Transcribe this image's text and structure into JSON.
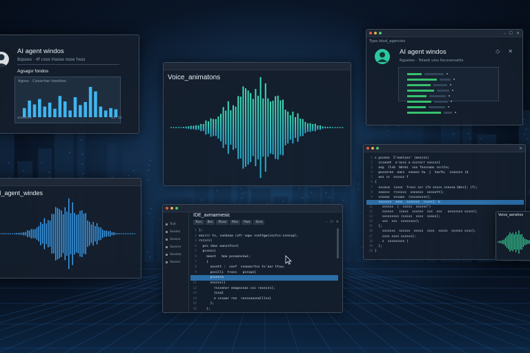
{
  "colors": {
    "background": "#0a1628",
    "accent_teal": "#3ee0b0",
    "accent_blue": "#4fb8e8",
    "window_bg": "#141e2c",
    "green_progress": "#38c16e",
    "highlight_line": "#2b6ea8"
  },
  "agent_window_left": {
    "title": "AI agent windos",
    "subtitle": "Bqsses · 4f coss Hasse osse hsss",
    "section": "Agsagsr fondos",
    "panel_title": "Agsss · Cossnhar toodoss",
    "footer_left": "sssssssss",
    "footer_right": "11 · 12",
    "bar_values": [
      0.3,
      0.55,
      0.42,
      0.6,
      0.35,
      0.48,
      0.28,
      0.7,
      0.52,
      0.22,
      0.66,
      0.4,
      0.5,
      1.0,
      0.85,
      0.35,
      0.22,
      0.3,
      0.26
    ],
    "icons": {
      "avatar": "user-avatar-icon"
    }
  },
  "voice_window": {
    "title": "Voice_animatons"
  },
  "agent_window_right": {
    "title_bar_label": "Typo   blod_agercios",
    "title": "AI agent windos",
    "subtitle": "Rgsates · Tolastl ulss llscsosrsatts",
    "control_a": "◇",
    "control_b": "✕",
    "progress": [
      0.3,
      0.62,
      0.48,
      0.55,
      0.4,
      0.5,
      0.38,
      0.7
    ],
    "icons": {
      "avatar": "agent-avatar-icon"
    }
  },
  "audio_window_left": {
    "title": "I_agent_windes"
  },
  "ide_window": {
    "title_bar": "",
    "title": "IDE_avmarmesic",
    "tabs": [
      "Tocs",
      "Bss",
      "Ploas",
      "Moc",
      "Pwo",
      "Ssra"
    ],
    "sidebar_items": [
      "Tcot",
      "Sossks",
      "Sossco",
      "Sossrer",
      "Sosslas",
      "Sosses"
    ],
    "code_lines": [
      {
        "n": "1",
        "t": "};",
        "hl": false
      },
      {
        "n": "2",
        "t": "eosrcr ts, sasknaa (ofr vapv ssnttgw(ssctcs-ssnssp};",
        "hl": false
      },
      {
        "n": "3",
        "t": "rs(nrs)",
        "hl": false
      },
      {
        "n": "4",
        "t": "  pss skoc oanssfsssl",
        "hl": false
      },
      {
        "n": "5",
        "t": "  pcsnss(",
        "hl": false
      },
      {
        "n": "6",
        "t": "    anest   boo pssoonsnwi;",
        "hl": false
      },
      {
        "n": "7",
        "t": "    {",
        "hl": false
      },
      {
        "n": "8",
        "t": "      assntt :  cosf  svnoasrtss ts'aar ttsw;",
        "hl": false
      },
      {
        "n": "9",
        "t": "      pssilli  t+oss   pssspn{",
        "hl": false
      },
      {
        "n": "10",
        "t": "      pssnssa",
        "hl": true
      },
      {
        "n": "11",
        "t": "      nsssss()",
        "hl": false
      },
      {
        "n": "12",
        "t": "        rsssensr enapsssas ssc rosssss];",
        "hl": false
      },
      {
        "n": "13",
        "t": "        {ssa}",
        "hl": false
      },
      {
        "n": "14",
        "t": "        e cssoor rnn  rosssonsnalllss}",
        "hl": false
      },
      {
        "n": "15",
        "t": "      };",
        "hl": false
      },
      {
        "n": "16",
        "t": "    };",
        "hl": false
      }
    ],
    "icons": {
      "cursor": "mouse-cursor-icon"
    }
  },
  "code_window_right": {
    "code_lines": [
      {
        "n": "1",
        "t": "c pscoon  5'oonloss' (eessss)",
        "hl": false
      },
      {
        "n": "2",
        "t": "  ccsonnt  o'osss o sssrorr sossss}",
        "hl": false
      },
      {
        "n": "3",
        "t": "  asp  llsb  bhrmi  sxx fosssaas ssrslo;",
        "hl": false
      },
      {
        "n": "4",
        "t": "  posseroo  oass  snoass tw  j  tasfn;  ssassss ($",
        "hl": false
      },
      {
        "n": "5",
        "t": "  ass rs  ssssss f",
        "hl": false
      },
      {
        "n": "6",
        "t": "{",
        "hl": false
      },
      {
        "n": "7",
        "t": "  sscoca  (soss  frosc ssr ifn sssss ssossa hdss]; (f);",
        "hl": false
      },
      {
        "n": "8",
        "t": "  soosss  r(ssssc  ssnsoss  ossostt];",
        "hl": false
      },
      {
        "n": "9",
        "t": "  ssosas  sssoas  (ssssossss];",
        "hl": false
      },
      {
        "n": "10",
        "t": "  sssssss  soss  sssssss  (ssss]; b",
        "hl": true
      },
      {
        "n": "11",
        "t": "    ssssss  |  sssss  ssssss\")",
        "hl": false
      },
      {
        "n": "12",
        "t": "    ssssss   (soss  ssssss  sss  sss   osssssss sssss];",
        "hl": false
      },
      {
        "n": "13",
        "t": "    sssssssss (sssss  ssss  ssoss];",
        "hl": false
      },
      {
        "n": "14",
        "t": "    sss  sss  ssssssss];",
        "hl": false
      },
      {
        "n": "15",
        "t": "  };",
        "hl": false
      },
      {
        "n": "16",
        "t": "    sssssss  ssssss  ossss  ssss  sssss  ssssss ssss];",
        "hl": false
      },
      {
        "n": "17",
        "t": "    ssss ssss ssssss];",
        "hl": false
      },
      {
        "n": "18",
        "t": "    s  sssssssss (",
        "hl": false
      },
      {
        "n": "19",
        "t": "  };",
        "hl": false
      },
      {
        "n": "20",
        "t": "}",
        "hl": false
      }
    ]
  },
  "mini_window": {
    "title": "Voice_aeratios"
  }
}
